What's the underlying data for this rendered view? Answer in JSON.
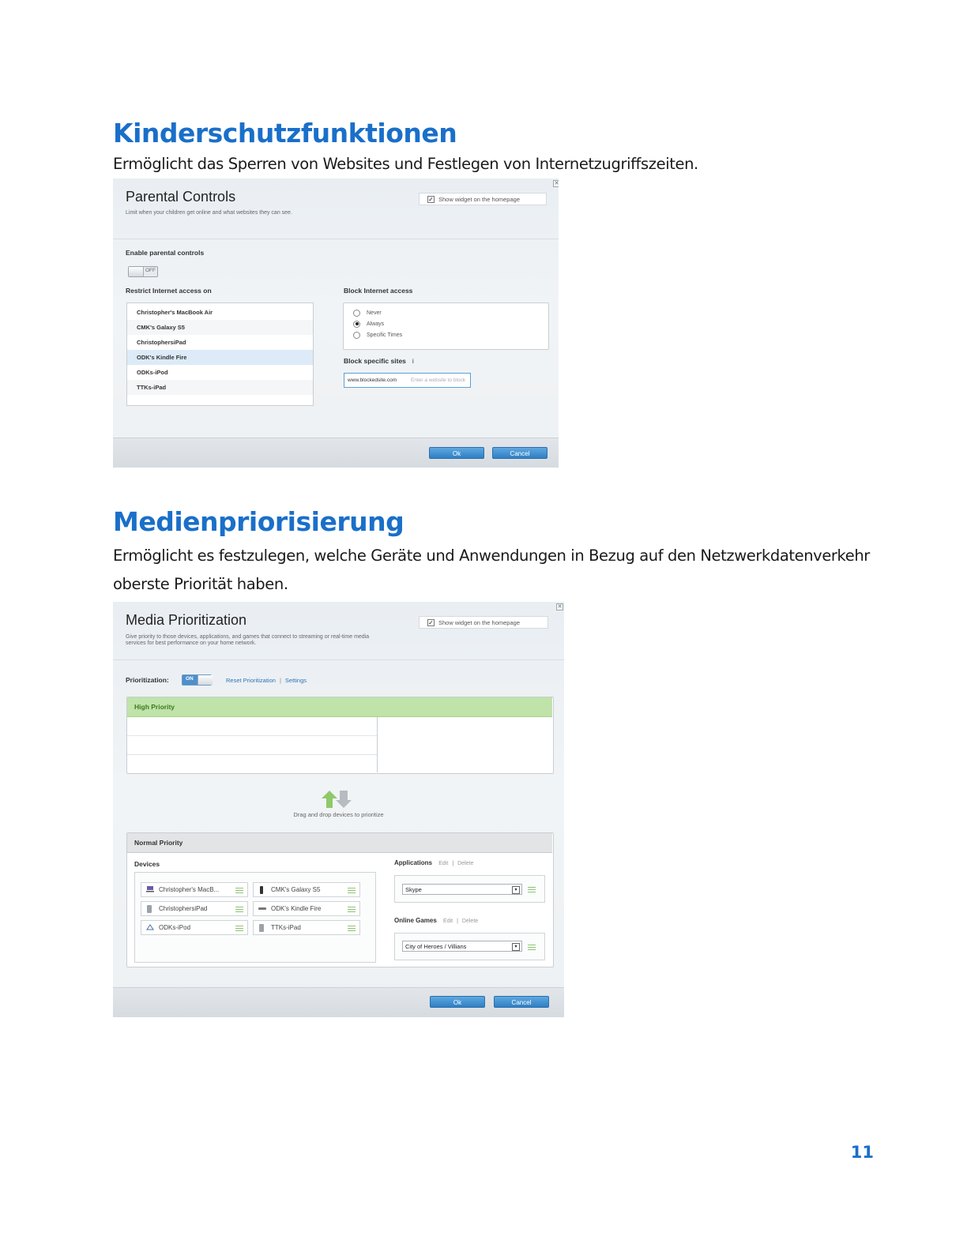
{
  "section1": {
    "heading": "Kinderschutzfunktionen",
    "description": "Ermöglicht das Sperren von Websites und Festlegen von Internetzugriffszeiten.",
    "screenshot": {
      "title": "Parental Controls",
      "subtitle": "Limit when your children get online and what websites they can see.",
      "close": "✕",
      "widget_label": "Show widget on the homepage",
      "enable_label": "Enable parental controls",
      "toggle_state": "OFF",
      "restrict_label": "Restrict Internet access on",
      "devices": [
        "Christopher's MacBook Air",
        "CMK's Galaxy S5",
        "ChristophersiPad",
        "ODK's Kindle Fire",
        "ODKs-iPod",
        "TTKs-iPad"
      ],
      "block_label": "Block Internet access",
      "block_options": [
        "Never",
        "Always",
        "Specific Times"
      ],
      "block_selected": "Always",
      "sites_label": "Block specific sites",
      "sites_info": "i",
      "site_value": "www.blockedsite.com",
      "site_placeholder": "Enter a website to block",
      "ok": "Ok",
      "cancel": "Cancel"
    }
  },
  "section2": {
    "heading": "Medienpriorisierung",
    "description_line1": "Ermöglicht es festzulegen, welche Geräte und Anwendungen in Bezug auf den Netzwerkdatenverkehr",
    "description_line2": "oberste Priorität haben.",
    "screenshot": {
      "title": "Media Prioritization",
      "subtitle_line1": "Give priority to those devices, applications, and games that connect to streaming or real-time media",
      "subtitle_line2": "services for best performance on your home network.",
      "close": "✕",
      "widget_label": "Show widget on the homepage",
      "prioritization_label": "Prioritization:",
      "toggle_state": "ON",
      "reset_link": "Reset Prioritization",
      "settings_link": "Settings",
      "high_priority": "High Priority",
      "drag_hint": "Drag and drop devices to prioritize",
      "normal_priority": "Normal Priority",
      "devices_label": "Devices",
      "devices": [
        {
          "name": "Christopher's MacB...",
          "icon": "laptop-icon"
        },
        {
          "name": "CMK's Galaxy S5",
          "icon": "phone-icon"
        },
        {
          "name": "ChristophersiPad",
          "icon": "tablet-icon"
        },
        {
          "name": "ODK's Kindle Fire",
          "icon": "kindle-icon"
        },
        {
          "name": "ODKs-iPod",
          "icon": "ipod-icon"
        },
        {
          "name": "TTKs-iPad",
          "icon": "tablet-icon"
        }
      ],
      "applications_label": "Applications",
      "edit": "Edit",
      "delete": "Delete",
      "application_value": "Skype",
      "online_games_label": "Online Games",
      "game_value": "City of Heroes / Villians",
      "ok": "Ok",
      "cancel": "Cancel"
    }
  },
  "page_number": "11",
  "colors": {
    "heading": "#1a6fc9",
    "button": "#3b8ad0",
    "high_priority": "#bfe3a8"
  }
}
